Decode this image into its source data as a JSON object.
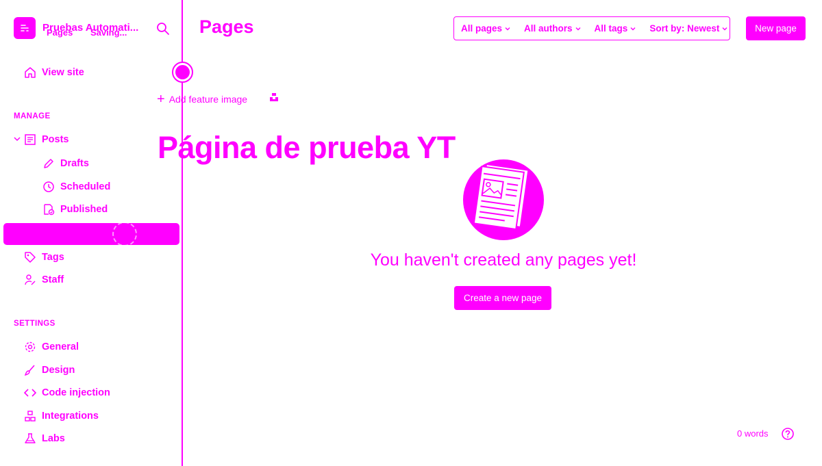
{
  "sidebar": {
    "brand_name": "Pruebas Automati...",
    "brand_overlay": {
      "crumb": "Pages",
      "status": "Saving..."
    },
    "view_site": "View site",
    "manage_label": "MANAGE",
    "posts": "Posts",
    "drafts": "Drafts",
    "scheduled": "Scheduled",
    "published": "Published",
    "tags": "Tags",
    "staff": "Staff",
    "settings_label": "SETTINGS",
    "general": "General",
    "design": "Design",
    "code_injection": "Code injection",
    "integrations": "Integrations",
    "labs": "Labs"
  },
  "header": {
    "title": "Pages",
    "filters": [
      "All pages",
      "All authors",
      "All tags",
      "Sort by: Newest"
    ],
    "new_page": "New page"
  },
  "editor": {
    "add_feature_image": "Add feature image",
    "title": "Página de prueba YT"
  },
  "empty_state": {
    "message": "You haven't created any pages yet!",
    "cta": "Create a new page"
  },
  "footer": {
    "word_count": "0 words"
  },
  "colors": {
    "accent": "#ff00ff",
    "background": "#ffffff"
  },
  "icons": [
    "menu-icon",
    "search-icon",
    "home-icon",
    "posts-icon",
    "pencil-icon",
    "clock-icon",
    "published-icon",
    "tag-icon",
    "staff-icon",
    "gear-icon",
    "brush-icon",
    "code-icon",
    "integrations-icon",
    "flask-icon",
    "help-icon"
  ]
}
